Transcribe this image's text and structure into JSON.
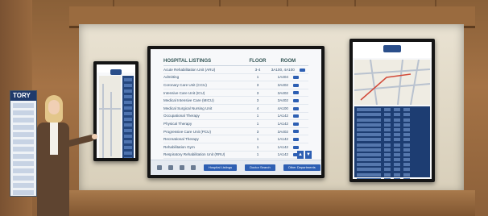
{
  "scene": {
    "description_colors": {
      "wood": "#a57346",
      "screen_bg": "#f7f8fa",
      "accent_blue": "#2d5fb3",
      "navy": "#1d3d72"
    }
  },
  "wall_sign": {
    "title": "TORY"
  },
  "center_screen": {
    "header": {
      "col1": "HOSPITAL LISTINGS",
      "col2": "FLOOR",
      "col3": "ROOM"
    },
    "rows": [
      {
        "name": "Acute Rehabilitation Unit (ARU)",
        "floor": "3-4",
        "room": "3A100, 4A100"
      },
      {
        "name": "Admitting",
        "floor": "1",
        "room": "1A404"
      },
      {
        "name": "Coronary Care Unit (CCU)",
        "floor": "3",
        "room": "3A402"
      },
      {
        "name": "Intensive Care Unit (ICU)",
        "floor": "3",
        "room": "3A402"
      },
      {
        "name": "Medical Intensive Care (MICU)",
        "floor": "3",
        "room": "3A402"
      },
      {
        "name": "Medical Surgical Nursing Unit",
        "floor": "4",
        "room": "4A100"
      },
      {
        "name": "Occupational Therapy",
        "floor": "1",
        "room": "1A142"
      },
      {
        "name": "Physical Therapy",
        "floor": "1",
        "room": "1A142"
      },
      {
        "name": "Progressive Care Unit (PCU)",
        "floor": "3",
        "room": "3A402"
      },
      {
        "name": "Recreational Therapy",
        "floor": "1",
        "room": "1A142"
      },
      {
        "name": "Rehabilitation Gym",
        "floor": "1",
        "room": "1A142"
      },
      {
        "name": "Respiratory Rehabilitation Unit (RRU)",
        "floor": "1",
        "room": "1A142"
      }
    ],
    "footer_buttons": [
      "Hospital Listings",
      "Doctor Search",
      "Other Departments"
    ],
    "scroll_arrows": [
      "▲",
      "▼"
    ]
  }
}
